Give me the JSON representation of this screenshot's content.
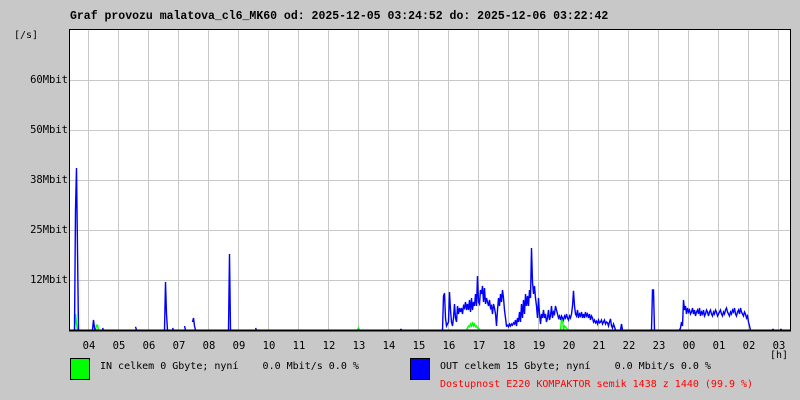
{
  "title": "Graf provozu malatova_cl6_MK60 od: 2025-12-05 03:24:52 do: 2025-12-06 03:22:42",
  "chart_data": {
    "type": "line",
    "title": "Graf provozu malatova_cl6_MK60 od: 2025-12-05 03:24:52 do: 2025-12-06 03:22:42",
    "ylabel": "[/s]",
    "xlabel": "[h]",
    "ylim": [
      0,
      75
    ],
    "y_unit": "Mbit",
    "y_ticks": [
      {
        "value": 12.5,
        "label": "12Mbit"
      },
      {
        "value": 25,
        "label": "25Mbit"
      },
      {
        "value": 37.5,
        "label": "38Mbit"
      },
      {
        "value": 50,
        "label": "50Mbit"
      },
      {
        "value": 62.5,
        "label": "60Mbit"
      }
    ],
    "sample_interval_min": 2,
    "sample_count": 720,
    "x_ticks": [
      {
        "index": 18,
        "label": "04"
      },
      {
        "index": 48,
        "label": "05"
      },
      {
        "index": 78,
        "label": "06"
      },
      {
        "index": 108,
        "label": "07"
      },
      {
        "index": 138,
        "label": "08"
      },
      {
        "index": 168,
        "label": "09"
      },
      {
        "index": 198,
        "label": "10"
      },
      {
        "index": 228,
        "label": "11"
      },
      {
        "index": 258,
        "label": "12"
      },
      {
        "index": 288,
        "label": "13"
      },
      {
        "index": 318,
        "label": "14"
      },
      {
        "index": 348,
        "label": "15"
      },
      {
        "index": 378,
        "label": "16"
      },
      {
        "index": 408,
        "label": "17"
      },
      {
        "index": 438,
        "label": "18"
      },
      {
        "index": 468,
        "label": "19"
      },
      {
        "index": 498,
        "label": "20"
      },
      {
        "index": 528,
        "label": "21"
      },
      {
        "index": 558,
        "label": "22"
      },
      {
        "index": 588,
        "label": "23"
      },
      {
        "index": 618,
        "label": "00"
      },
      {
        "index": 648,
        "label": "01"
      },
      {
        "index": 678,
        "label": "02"
      },
      {
        "index": 708,
        "label": "03"
      }
    ],
    "grid": true,
    "series": [
      {
        "name": "IN",
        "color": "#00ff00",
        "segments": [
          {
            "start": 4,
            "values": [
              0,
              4,
              1.5,
              0
            ]
          },
          {
            "start": 25,
            "values": [
              0,
              1.2,
              1.2,
              0
            ]
          },
          {
            "start": 287,
            "values": [
              0,
              0.5,
              0
            ]
          },
          {
            "start": 396,
            "values": [
              0,
              0.5,
              1,
              0.8,
              1.5,
              1,
              2,
              1,
              1.5,
              0.8,
              1,
              0.5,
              0.5,
              0
            ]
          },
          {
            "start": 490,
            "values": [
              0,
              2.8,
              2.8,
              0,
              1,
              0.8,
              0.5,
              0
            ]
          }
        ]
      },
      {
        "name": "OUT",
        "color": "#0000ff",
        "segments": [
          {
            "start": 4,
            "values": [
              0,
              30,
              40.5,
              20,
              0
            ]
          },
          {
            "start": 22,
            "values": [
              0,
              2.5,
              0.5,
              0
            ]
          },
          {
            "start": 32,
            "values": [
              0.5,
              0
            ]
          },
          {
            "start": 65,
            "values": [
              0.8,
              0
            ]
          },
          {
            "start": 94,
            "values": [
              0,
              12,
              4,
              0
            ]
          },
          {
            "start": 102,
            "values": [
              0.5,
              0
            ]
          },
          {
            "start": 114,
            "values": [
              1,
              0
            ]
          },
          {
            "start": 122,
            "values": [
              2,
              3,
              1,
              0
            ]
          },
          {
            "start": 158,
            "values": [
              0,
              19,
              0
            ]
          },
          {
            "start": 185,
            "values": [
              0.5,
              0
            ]
          },
          {
            "start": 330,
            "values": [
              0.3,
              0
            ]
          },
          {
            "start": 372,
            "values": [
              0,
              8.5,
              9.2,
              3,
              1,
              1.5,
              2,
              9.5,
              5,
              2,
              1,
              3,
              6.5,
              3,
              2,
              6,
              4,
              5.5,
              4.5,
              5.5,
              4,
              6,
              5.5,
              7,
              5,
              6.5,
              5,
              7.5,
              4.5,
              8,
              5,
              7,
              6,
              9,
              6,
              13.5,
              7,
              6.5,
              10,
              9,
              11,
              7,
              10.5,
              6.5,
              8,
              7,
              6,
              7.5,
              5.5,
              6,
              4,
              6.5,
              5.5,
              4,
              1,
              5,
              8,
              6,
              9,
              7,
              10,
              8,
              5,
              3,
              1,
              1.2,
              0.8,
              1.5,
              1,
              1.5,
              1.2,
              1.8,
              1.5,
              2.5,
              1,
              3,
              2,
              4.5,
              2,
              6.5,
              3,
              7.5,
              4,
              9,
              6,
              8.5,
              6,
              10,
              8,
              20.5,
              12,
              9,
              11,
              8,
              6,
              3,
              8,
              4,
              1.5,
              4,
              3,
              5,
              3,
              4,
              2,
              3,
              5,
              2.5,
              3.5,
              6,
              3,
              4.5,
              4,
              6,
              5,
              4,
              3,
              3.5,
              2.5,
              3.5,
              3,
              2.5,
              3.5,
              3,
              4,
              3,
              2.5,
              3.5,
              3,
              4,
              6,
              9.8,
              6,
              4,
              3.5,
              5,
              3,
              4,
              3.5,
              4.5,
              3,
              4,
              3,
              4.5,
              3.5,
              4,
              3,
              4,
              2.5,
              3.5,
              3,
              2,
              2.5,
              1.8,
              2.2,
              1.5,
              2.5,
              1.8,
              2,
              2.5,
              1.5,
              2,
              2.5,
              1.5,
              2,
              1.8,
              1,
              2,
              2.8,
              1,
              0.5,
              1.5,
              0.8,
              0
            ]
          },
          {
            "start": 550,
            "values": [
              0,
              1.5,
              0
            ]
          },
          {
            "start": 581,
            "values": [
              0,
              10,
              10,
              0
            ]
          },
          {
            "start": 609,
            "values": [
              0,
              0.5,
              2,
              1,
              7.5,
              5,
              6,
              4,
              5.5,
              4.5,
              5,
              4,
              4.5,
              5.5,
              4,
              5,
              3.5,
              4.5,
              5,
              4,
              5.5,
              3.5,
              4.5,
              4,
              5,
              3.5,
              4,
              5,
              4.5,
              3.5,
              4.5,
              5,
              4,
              3.5,
              4.5,
              4,
              5,
              4.5,
              3.5,
              4,
              4.5,
              5,
              4,
              3.5,
              4.5,
              4,
              5,
              5.5,
              4.5,
              4,
              3.5,
              4.5,
              4,
              5,
              4.5,
              5.5,
              4,
              3.5,
              4.5,
              5,
              4,
              5.5,
              4.5,
              4,
              3.5,
              4.5,
              4,
              3,
              3.5,
              2,
              1,
              0
            ]
          },
          {
            "start": 702,
            "values": [
              0.3,
              0
            ]
          },
          {
            "start": 710,
            "values": [
              0.3,
              0
            ]
          }
        ]
      }
    ]
  },
  "legend": {
    "in_color": "#00ff00",
    "out_color": "#0000ff",
    "in_text": "IN celkem 0 Gbyte; nyní    0.0 Mbit/s 0.0 %",
    "out_text": "OUT celkem 15 Gbyte; nyní    0.0 Mbit/s 0.0 %",
    "availability": "Dostupnost E220 KOMPAKTOR semik 1438 z 1440 (99.9 %)",
    "availability_color": "#ff0000"
  }
}
